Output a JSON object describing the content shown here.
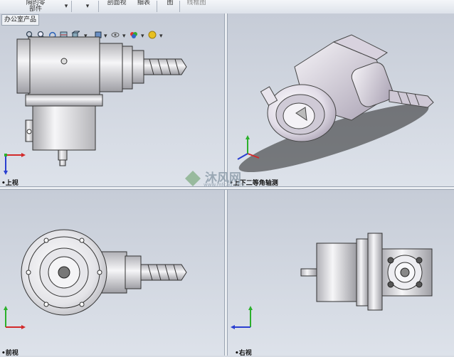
{
  "toolbar": {
    "items": [
      {
        "label": "隔的零\n部件"
      },
      {
        "label": "剖面视"
      },
      {
        "label": "细表"
      },
      {
        "label": "图"
      },
      {
        "label": "线框图"
      }
    ]
  },
  "tab_label": "办公室产品",
  "viewports": {
    "top": {
      "label": "•上视"
    },
    "iso": {
      "label": "•上下二等角轴测"
    },
    "front": {
      "label": "•前视"
    },
    "right": {
      "label": "•右视"
    }
  },
  "watermark": {
    "text": "沐风网",
    "url": "www.mfcad.com"
  },
  "icons": [
    "zoom-icon",
    "rotate-icon",
    "pan-icon",
    "section-icon",
    "view-orient-icon",
    "display-style-icon",
    "appearance-icon",
    "scene-icon"
  ],
  "colors": {
    "axis_x": "#d22a2a",
    "axis_y": "#2bb02b",
    "axis_z": "#2a3fd0"
  }
}
